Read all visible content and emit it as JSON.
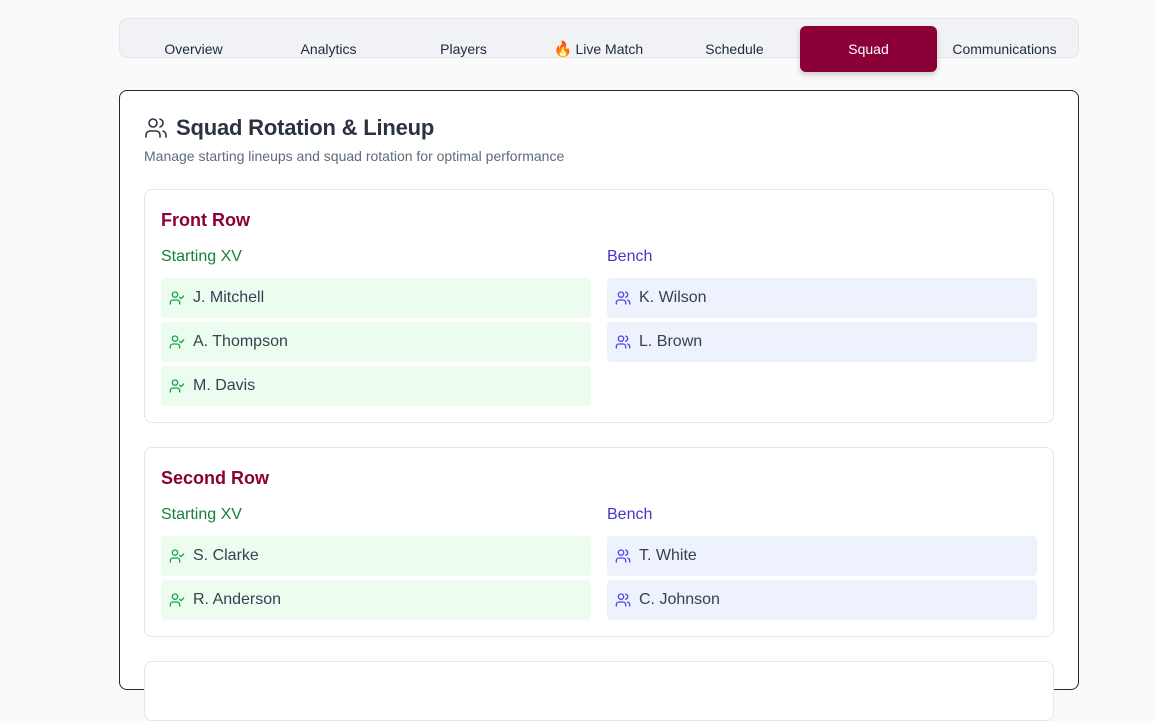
{
  "tabs": [
    {
      "label": "Overview",
      "active": false
    },
    {
      "label": "Analytics",
      "active": false
    },
    {
      "label": "Players",
      "active": false
    },
    {
      "label": "Live Match",
      "icon": "fire-icon",
      "active": false
    },
    {
      "label": "Schedule",
      "active": false
    },
    {
      "label": "Squad",
      "active": true
    },
    {
      "label": "Communications",
      "active": false
    }
  ],
  "page": {
    "icon": "users-icon",
    "title": "Squad Rotation & Lineup",
    "subtitle": "Manage starting lineups and squad rotation for optimal performance"
  },
  "groups": [
    {
      "title": "Front Row",
      "starting_label": "Starting XV",
      "bench_label": "Bench",
      "starting": [
        "J. Mitchell",
        "A. Thompson",
        "M. Davis"
      ],
      "bench": [
        "K. Wilson",
        "L. Brown"
      ]
    },
    {
      "title": "Second Row",
      "starting_label": "Starting XV",
      "bench_label": "Bench",
      "starting": [
        "S. Clarke",
        "R. Anderson"
      ],
      "bench": [
        "T. White",
        "C. Johnson"
      ]
    }
  ],
  "colors": {
    "accent": "#8b0037",
    "starting_text": "#15803d",
    "starting_bg": "#ecfdf0",
    "bench_text": "#4338ca",
    "bench_bg": "#edf2fd"
  }
}
